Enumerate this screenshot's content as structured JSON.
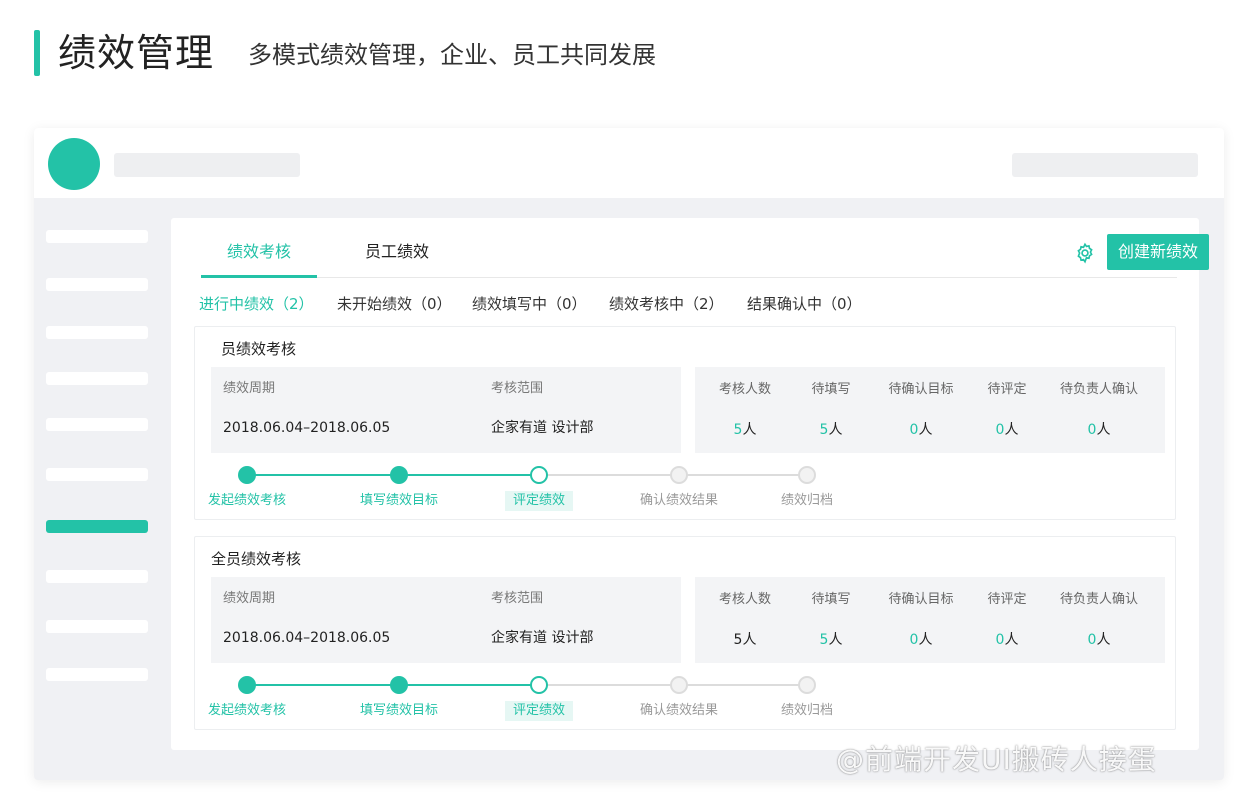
{
  "header": {
    "title": "绩效管理",
    "subtitle": "多模式绩效管理，企业、员工共同发展"
  },
  "colors": {
    "accent": "#23c2a7",
    "sidebar_bg": "#f0f1f4",
    "placeholder": "#eeeff1"
  },
  "sidebar": {
    "item_count": 10,
    "active_index": 6
  },
  "tabs": [
    {
      "label": "绩效考核",
      "active": true
    },
    {
      "label": "员工绩效",
      "active": false
    }
  ],
  "toolbar": {
    "settings_icon": "gear-icon",
    "create_label": "创建新绩效"
  },
  "filters": [
    {
      "label": "进行中绩效（2）",
      "active": true
    },
    {
      "label": "未开始绩效（0）",
      "active": false
    },
    {
      "label": "绩效填写中（0）",
      "active": false
    },
    {
      "label": "绩效考核中（2）",
      "active": false
    },
    {
      "label": "结果确认中（0）",
      "active": false
    }
  ],
  "info_labels": {
    "period": "绩效周期",
    "scope": "考核范围"
  },
  "stat_labels": [
    "考核人数",
    "待填写",
    "待确认目标",
    "待评定",
    "待负责人确认"
  ],
  "step_labels": [
    "发起绩效考核",
    "填写绩效目标",
    "评定绩效",
    "确认绩效结果",
    "绩效归档"
  ],
  "reviews": [
    {
      "title": "员绩效考核",
      "period": "2018.06.04–2018.06.05",
      "scope": "企家有道 设计部",
      "stats": [
        {
          "num": "5",
          "unit": "人",
          "highlight": true
        },
        {
          "num": "5",
          "unit": "人",
          "highlight": true
        },
        {
          "num": "0",
          "unit": "人",
          "highlight": true
        },
        {
          "num": "0",
          "unit": "人",
          "highlight": true
        },
        {
          "num": "0",
          "unit": "人",
          "highlight": true
        }
      ],
      "current_step": 2
    },
    {
      "title": "全员绩效考核",
      "period": "2018.06.04–2018.06.05",
      "scope": "企家有道 设计部",
      "stats": [
        {
          "num": "5",
          "unit": "人",
          "highlight": false
        },
        {
          "num": "5",
          "unit": "人",
          "highlight": true
        },
        {
          "num": "0",
          "unit": "人",
          "highlight": true
        },
        {
          "num": "0",
          "unit": "人",
          "highlight": true
        },
        {
          "num": "0",
          "unit": "人",
          "highlight": true
        }
      ],
      "current_step": 2
    }
  ],
  "watermark": "@前端开发UI搬砖人接蛋"
}
